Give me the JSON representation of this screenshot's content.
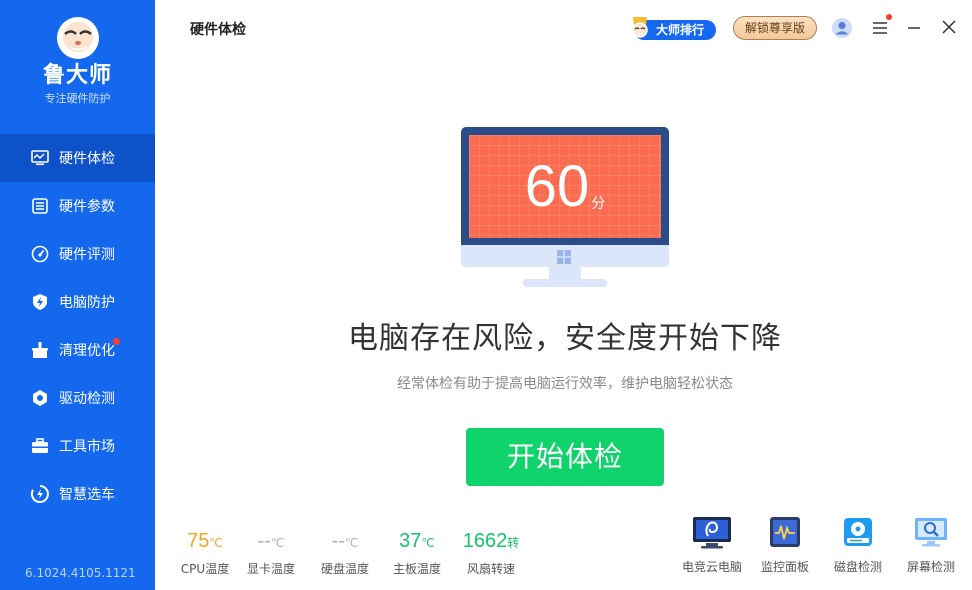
{
  "sidebar": {
    "brand": "鲁大师",
    "tagline": "专注硬件防护",
    "items": [
      {
        "label": "硬件体检",
        "icon": "monitor-check-icon",
        "active": true
      },
      {
        "label": "硬件参数",
        "icon": "parameters-icon"
      },
      {
        "label": "硬件评测",
        "icon": "gauge-icon"
      },
      {
        "label": "电脑防护",
        "icon": "shield-icon"
      },
      {
        "label": "清理优化",
        "icon": "broom-icon",
        "badge": true
      },
      {
        "label": "驱动检测",
        "icon": "gear-icon"
      },
      {
        "label": "工具市场",
        "icon": "toolbox-icon"
      },
      {
        "label": "智慧选车",
        "icon": "car-icon"
      }
    ],
    "version": "6.1024.4105.1121"
  },
  "header": {
    "title": "硬件体检",
    "rank_label": "大师排行",
    "vip_label": "解锁尊享版"
  },
  "main": {
    "score": "60",
    "score_unit": "分",
    "headline": "电脑存在风险，安全度开始下降",
    "subline": "经常体检有助于提高电脑运行效率，维护电脑轻松状态",
    "start_label": "开始体检"
  },
  "stats": [
    {
      "value": "75",
      "unit": "℃",
      "label": "CPU温度",
      "color": "#f5a623"
    },
    {
      "value": "--",
      "unit": "℃",
      "label": "显卡温度",
      "color": "#b0b0b0"
    },
    {
      "value": "--",
      "unit": "℃",
      "label": "硬盘温度",
      "color": "#b0b0b0"
    },
    {
      "value": "37",
      "unit": "℃",
      "label": "主板温度",
      "color": "#14c46a"
    },
    {
      "value": "1662",
      "unit": "转",
      "label": "风扇转速",
      "color": "#14c46a"
    }
  ],
  "tools": [
    {
      "label": "电竞云电脑",
      "icon": "cloud-pc-icon"
    },
    {
      "label": "监控面板",
      "icon": "monitor-panel-icon"
    },
    {
      "label": "磁盘检测",
      "icon": "disk-check-icon"
    },
    {
      "label": "屏幕检测",
      "icon": "screen-check-icon"
    }
  ],
  "colors": {
    "sidebar": "#1468ee",
    "sidebar_active": "#0e52c9",
    "score_screen": "#fa6b4f",
    "start_button": "#11d36b"
  }
}
